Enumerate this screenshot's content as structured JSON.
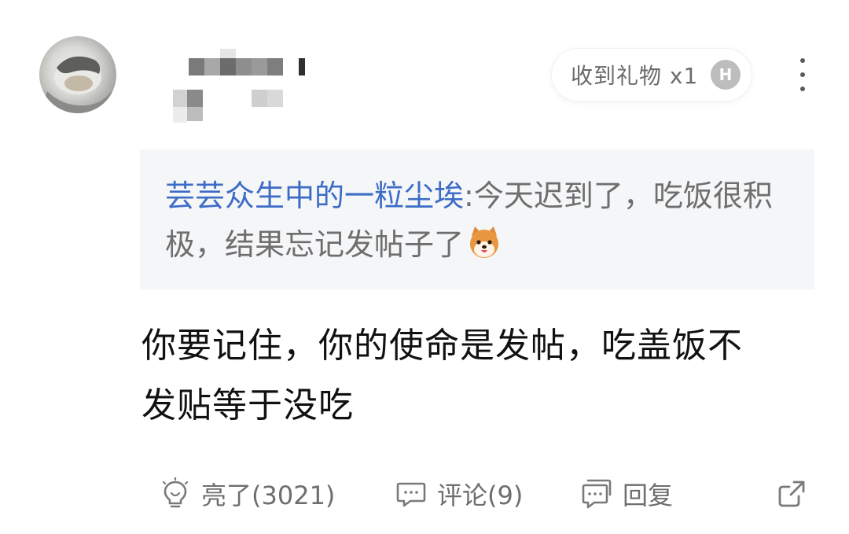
{
  "post": {
    "gift": {
      "label": "收到礼物 x1",
      "badge": "H"
    },
    "quote": {
      "author": "芸芸众生中的一粒尘埃",
      "separator": ":",
      "text": "今天迟到了，吃饭很积极，结果忘记发帖子了"
    },
    "comment": {
      "line1": "你要记住，你的使命是发帖，吃盖饭不",
      "line2": "发贴等于没吃"
    },
    "actions": {
      "like": "亮了(3021)",
      "comment": "评论(9)",
      "reply": "回复"
    }
  },
  "icons": {
    "avatar": "user-avatar",
    "more": "more-vertical-icon",
    "like": "lightbulb-icon",
    "comment": "comment-bubble-icon",
    "reply": "reply-bubbles-icon",
    "share": "share-external-icon",
    "emoji": "shiba-dog-emoji"
  },
  "colors": {
    "author_link": "#3d6cc6",
    "quote_bg": "#f5f6f8",
    "muted_text": "#6e6e6e",
    "body_text": "#111111"
  }
}
